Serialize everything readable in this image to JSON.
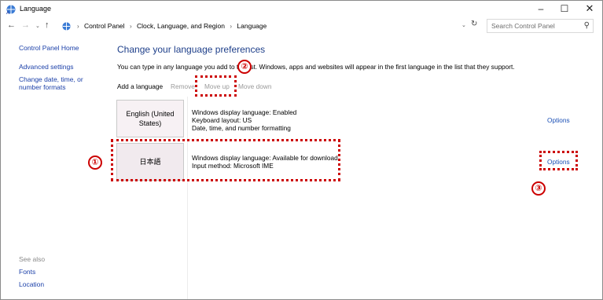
{
  "window": {
    "title": "Language",
    "min_glyph": "–",
    "max_glyph": "☐",
    "close_glyph": "✕"
  },
  "nav": {
    "back_glyph": "←",
    "forward_glyph": "→",
    "recent_glyph": "⌄",
    "up_glyph": "↑",
    "breadcrumbs": [
      "Control Panel",
      "Clock, Language, and Region",
      "Language"
    ],
    "crumb_separator": "›",
    "dropdown_glyph": "⌄",
    "refresh_glyph": "↻",
    "search_placeholder": "Search Control Panel",
    "search_glyph": "⚲"
  },
  "sidebar": {
    "home": "Control Panel Home",
    "advanced": "Advanced settings",
    "datetime": "Change date, time, or number formats",
    "see_also": "See also",
    "fonts": "Fonts",
    "location": "Location"
  },
  "main": {
    "title": "Change your language preferences",
    "description": "You can type in any language you add to the list. Windows, apps and websites will appear in the first language in the list that they support.",
    "toolbar": {
      "add": "Add a language",
      "remove": "Remove",
      "move_up": "Move up",
      "move_down": "Move down"
    },
    "languages": [
      {
        "name": "English (United States)",
        "details": [
          "Windows display language: Enabled",
          "Keyboard layout: US",
          "Date, time, and number formatting"
        ],
        "options": "Options"
      },
      {
        "name": "日本語",
        "details": [
          "Windows display language: Available for download",
          "Input method: Microsoft IME"
        ],
        "options": "Options"
      }
    ]
  },
  "annotations": {
    "marker_1": "①",
    "marker_2": "②",
    "marker_3": "③",
    "color": "#cc0000"
  },
  "colors": {
    "link": "#1a3fa8",
    "title": "#1e3f8a",
    "disabled": "#9a9a9a"
  }
}
